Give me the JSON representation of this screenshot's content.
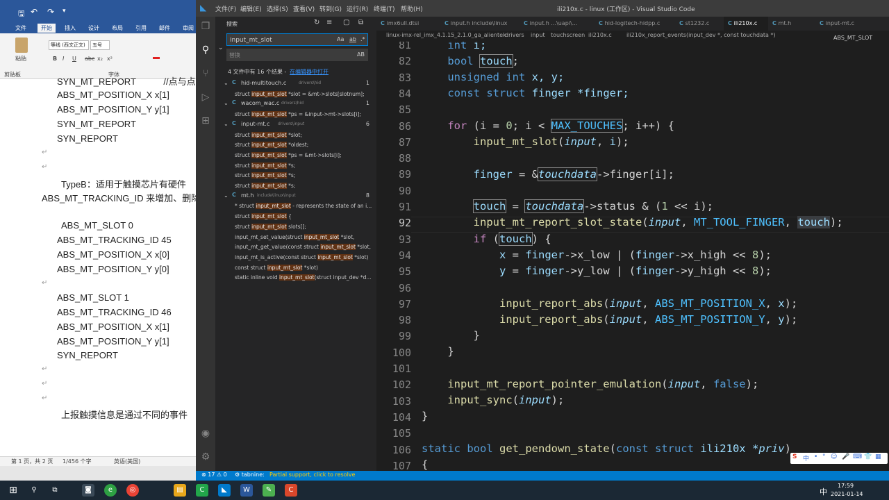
{
  "word": {
    "qa": [
      "🖫",
      "↶",
      "↷",
      "▾"
    ],
    "tabs": [
      "文件",
      "开始",
      "插入",
      "设计",
      "布局",
      "引用",
      "邮件",
      "审阅"
    ],
    "ribbon": {
      "paste": "粘贴",
      "clipboard": "剪贴板",
      "font_group": "字体",
      "font_name": "等线 (西文正文)",
      "font_size": "五号",
      "bold": "B",
      "italic": "I",
      "underline": "U",
      "strike": "abc",
      "sub": "x₂",
      "sup": "x²"
    },
    "doc_lines": [
      "SYN_MT_REPORT           //点与点",
      "ABS_MT_POSITION_X x[1]",
      "ABS_MT_POSITION_Y y[1]",
      "SYN_MT_REPORT",
      "SYN_REPORT",
      "TypeB：适用于触摸芯片有硬件",
      "ABS_MT_TRACKING_ID 来增加、删除",
      "ABS_MT_SLOT 0",
      "ABS_MT_TRACKING_ID 45",
      "ABS_MT_POSITION_X x[0]",
      "ABS_MT_POSITION_Y y[0]",
      "ABS_MT_SLOT 1",
      "ABS_MT_TRACKING_ID 46",
      "ABS_MT_POSITION_X x[1]",
      "ABS_MT_POSITION_Y y[1]",
      "SYN_REPORT",
      "上报触摸信息是通过不同的事件"
    ],
    "status": {
      "page": "第 1 页，共 2 页",
      "words": "1/456 个字",
      "lang": "英语(美国)"
    }
  },
  "vscode": {
    "menu": [
      "文件(F)",
      "编辑(E)",
      "选择(S)",
      "查看(V)",
      "转到(G)",
      "运行(R)",
      "终端(T)",
      "帮助(H)"
    ],
    "window_title": "ili210x.c - linux (工作区) - Visual Studio Code",
    "search": {
      "header": "搜索",
      "query": "input_mt_slot",
      "replace_placeholder": "替换",
      "summary": "4 文件中有 16 个结果 - ",
      "open_in_editor": "在编辑器中打开",
      "opt_case": "Aa",
      "opt_word": "ab",
      "opt_regex": ".*",
      "opt_preserve": "AB"
    },
    "results": [
      {
        "file": "hid-multitouch.c",
        "path": "drivers\\hid",
        "count": "1",
        "matches": [
          [
            "struct ",
            "input_mt_slot",
            " *slot = &mt->slots[slotnum];"
          ]
        ]
      },
      {
        "file": "wacom_wac.c",
        "path": "drivers\\hid",
        "count": "1",
        "matches": [
          [
            "struct ",
            "input_mt_slot",
            " *ps = &input->mt->slots[i];"
          ]
        ]
      },
      {
        "file": "input-mt.c",
        "path": "drivers\\input",
        "count": "6",
        "matches": [
          [
            "struct ",
            "input_mt_slot",
            " *slot;"
          ],
          [
            "struct ",
            "input_mt_slot",
            " *oldest;"
          ],
          [
            "struct ",
            "input_mt_slot",
            " *ps = &mt->slots[i];"
          ],
          [
            "struct ",
            "input_mt_slot",
            " *s;"
          ],
          [
            "struct ",
            "input_mt_slot",
            " *s;"
          ],
          [
            "struct ",
            "input_mt_slot",
            " *s;"
          ]
        ]
      },
      {
        "file": "mt.h",
        "path": "include\\linux\\input",
        "count": "8",
        "matches": [
          [
            "* struct ",
            "input_mt_slot",
            " - represents the state of an i..."
          ],
          [
            "struct ",
            "input_mt_slot",
            " {"
          ],
          [
            "struct ",
            "input_mt_slot",
            " slots[];"
          ],
          [
            "input_mt_set_value(struct ",
            "input_mt_slot",
            " *slot,"
          ],
          [
            "input_mt_get_value(const struct ",
            "input_mt_slot",
            " *slot,"
          ],
          [
            "input_mt_is_active(const struct ",
            "input_mt_slot",
            " *slot)"
          ],
          [
            "const struct ",
            "input_mt_slot",
            " *slot)"
          ],
          [
            "static inline void ",
            "input_mt_slot",
            "(struct input_dev *d..."
          ]
        ]
      }
    ],
    "tabs": [
      "imx6ull.dtsi",
      "input.h  include\\linux",
      "input.h  ...\\uapi\\...",
      "hid-logitech-hidpp.c",
      "st1232.c",
      "ili210x.c",
      "mt.h",
      "input-mt.c"
    ],
    "breadcrumb": [
      "linux-imx-rel_imx_4.1.15_2.1.0_ga_alientek",
      "drivers",
      "input",
      "touchscreen",
      "ili210x.c",
      "ili210x_report_events(input_dev *, const touchdata *)"
    ],
    "outline_label": "ABS_MT_SLOT",
    "line_numbers": [
      "81",
      "82",
      "83",
      "84",
      "85",
      "86",
      "87",
      "88",
      "89",
      "90",
      "91",
      "92",
      "93",
      "94",
      "95",
      "96",
      "97",
      "98",
      "99",
      "100",
      "101",
      "102",
      "103",
      "104",
      "105",
      "106",
      "107"
    ],
    "current_line": "92",
    "code": {
      "l81_type": "int",
      "l81_var": "i;",
      "bool": "bool",
      "touch": "touch",
      "unsigned_int": "unsigned int",
      "xy": "x, y;",
      "const_struct": "const struct",
      "finger_type": "finger",
      "finger_ptr": "*finger;",
      "for": "for",
      "for_init": "(i = ",
      "zero": "0",
      "for_cond": "; i < ",
      "max_touches": "MAX_TOUCHES",
      "for_inc": "; i++) {",
      "input_mt_slot": "input_mt_slot",
      "input": "input",
      "finger": "finger",
      "touchdata": "touchdata",
      "finger_arr": "->finger[i];",
      "status": "->status & (",
      "one": "1",
      "shift_i": " << i);",
      "report_slot_state": "input_mt_report_slot_state",
      "mt_tool_finger": "MT_TOOL_FINGER",
      "if": "if",
      "x": "x",
      "y": "y",
      "x_low": "->x_low | (",
      "x_high": "->x_high << ",
      "y_low": "->y_low | (",
      "y_high": "->y_high << ",
      "eight": "8",
      "input_report_abs": "input_report_abs",
      "abs_x": "ABS_MT_POSITION_X",
      "abs_y": "ABS_MT_POSITION_Y",
      "pointer_emulation": "input_mt_report_pointer_emulation",
      "false": "false",
      "input_sync": "input_sync",
      "static_bool": "static bool",
      "get_pendown_state": "get_pendown_state",
      "ili210x": "ili210x",
      "priv": "*priv"
    },
    "status": {
      "problems": "⊗ 17  ⚠ 0",
      "tabnine": "⚙ tabnine:",
      "partial": "Partial support, click to resolve"
    }
  },
  "ime": [
    "S",
    "中",
    "•",
    "°",
    "☺",
    "🎤",
    "⌨",
    "👕",
    "▦"
  ],
  "taskbar": {
    "time": "17:59",
    "date": "2021-01-14",
    "tray_lang": "中"
  }
}
